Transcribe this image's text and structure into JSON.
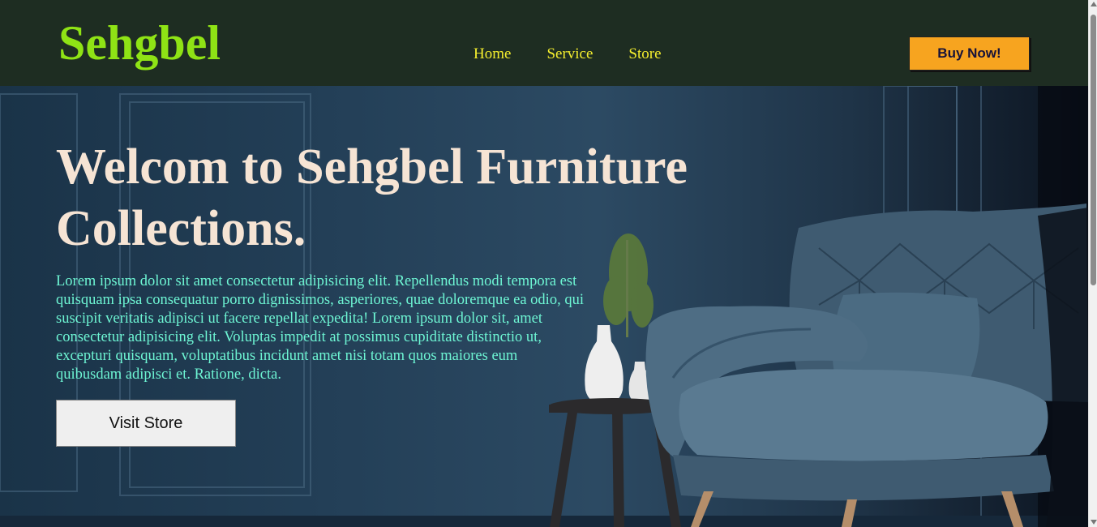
{
  "brand": {
    "name": "Sehgbel"
  },
  "nav": {
    "items": [
      {
        "label": "Home"
      },
      {
        "label": "Service"
      },
      {
        "label": "Store"
      }
    ],
    "cta_label": "Buy Now!"
  },
  "hero": {
    "title": "Welcom to Sehgbel Furniture Collections.",
    "body": "Lorem ipsum dolor sit amet consectetur adipisicing elit. Repellendus modi tempora est quisquam ipsa consequatur porro dignissimos, asperiores, quae doloremque ea odio, qui suscipit veritatis adipisci ut facere repellat expedita! Lorem ipsum dolor sit, amet consectetur adipisicing elit. Voluptas impedit at possimus cupiditate distinctio ut, excepturi quisquam, voluptatibus incidunt amet nisi totam quos maiores eum quibusdam adipisci et. Ratione, dicta.",
    "button_label": "Visit Store",
    "image_subject": "armchair-with-side-table-and-vases"
  },
  "colors": {
    "nav_bg": "#1e2d22",
    "logo": "#8fe315",
    "nav_link": "#f4ee2e",
    "cta_bg": "#f7a41f",
    "hero_title": "#f6e4d4",
    "hero_text": "#6ef6d4"
  }
}
